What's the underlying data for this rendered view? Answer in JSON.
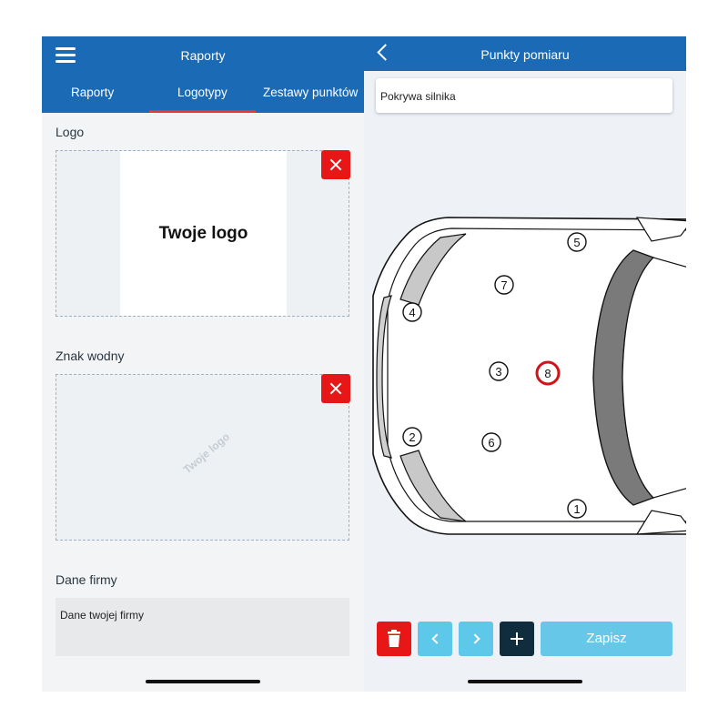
{
  "left": {
    "title": "Raporty",
    "tabs": [
      "Raporty",
      "Logotypy",
      "Zestawy punktów"
    ],
    "active_tab": "Logotypy",
    "logo_section": {
      "label": "Logo",
      "placeholder_text": "Twoje logo"
    },
    "watermark_section": {
      "label": "Znak wodny",
      "watermark_text": "Twoje logo"
    },
    "company_section": {
      "label": "Dane firmy",
      "value": "Dane twojej firmy"
    }
  },
  "right": {
    "title": "Punkty pomiaru",
    "field_value": "Pokrywa silnika",
    "points": [
      {
        "n": "1",
        "selected": false
      },
      {
        "n": "2",
        "selected": false
      },
      {
        "n": "3",
        "selected": false
      },
      {
        "n": "4",
        "selected": false
      },
      {
        "n": "5",
        "selected": false
      },
      {
        "n": "6",
        "selected": false
      },
      {
        "n": "7",
        "selected": false
      },
      {
        "n": "8",
        "selected": true
      }
    ],
    "save_label": "Zapisz"
  },
  "colors": {
    "brand_blue": "#1a6ab6",
    "delete_red": "#e81717",
    "tab_indicator": "#e53935",
    "nav_button": "#5ec8ea",
    "add_button": "#0f2d3d",
    "save_button": "#67c7e8",
    "selected_point": "#d0141b"
  },
  "icons": {
    "menu": "hamburger-icon",
    "remove": "close-icon",
    "back": "chevron-left-icon",
    "delete": "trash-icon",
    "prev": "chevron-left-icon",
    "next": "chevron-right-icon",
    "add": "plus-icon"
  }
}
